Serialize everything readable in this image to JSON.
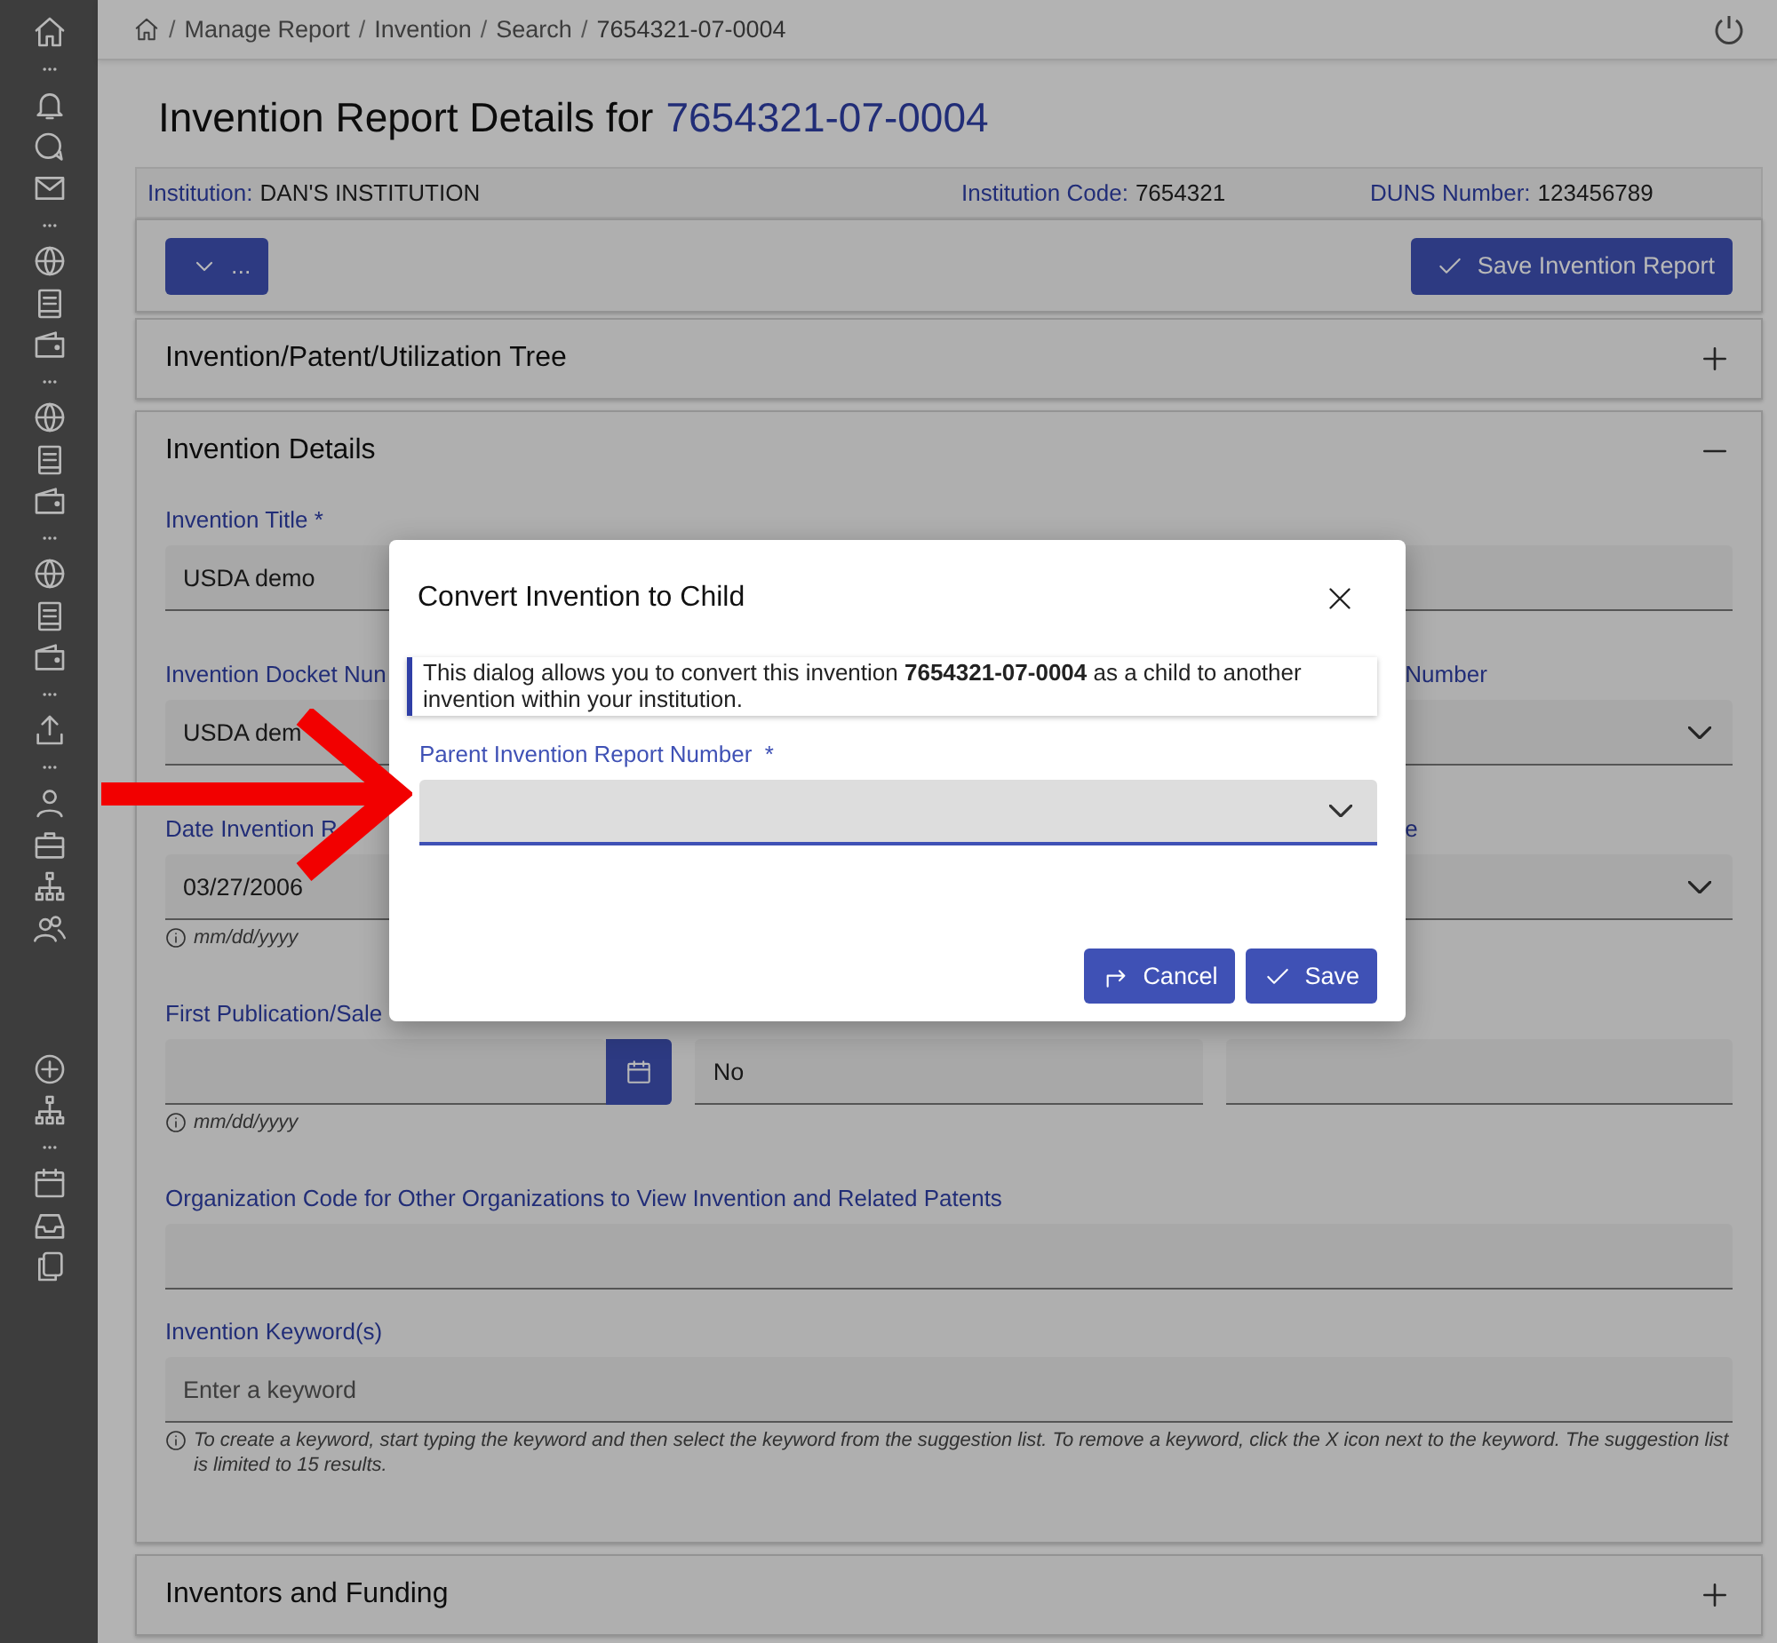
{
  "breadcrumb": [
    {
      "kind": "separator",
      "text": "/"
    },
    {
      "kind": "link",
      "text": "Manage Report"
    },
    {
      "kind": "separator",
      "text": "/"
    },
    {
      "kind": "link",
      "text": "Invention"
    },
    {
      "kind": "separator",
      "text": "/"
    },
    {
      "kind": "link",
      "text": "Search"
    },
    {
      "kind": "separator",
      "text": "/"
    },
    {
      "kind": "current",
      "text": "7654321-07-0004"
    }
  ],
  "page_title": {
    "text": "Invention Report Details for",
    "number": "7654321-07-0004"
  },
  "institution_bar": [
    {
      "label": "Institution:",
      "value": "DAN'S INSTITUTION"
    },
    {
      "label": "Institution Code:",
      "value": "7654321"
    },
    {
      "label": "DUNS Number:",
      "value": "123456789"
    }
  ],
  "toolbar": {
    "menu_button": "...",
    "save_button": "Save Invention Report"
  },
  "sections": [
    {
      "title": "Invention/Patent/Utilization Tree",
      "expanded": false
    },
    {
      "title": "Invention Details",
      "expanded": true
    },
    {
      "title": "Inventors and Funding",
      "expanded": false
    }
  ],
  "details_rows": [
    [
      {
        "label": "Invention Title *",
        "kind": "text",
        "value": "USDA demo"
      }
    ],
    [
      {
        "label": "Invention Docket Nun",
        "kind": "text",
        "value": "USDA dem"
      },
      {
        "label": "Number",
        "kind": "select"
      }
    ],
    [
      {
        "label": "Date Invention R",
        "kind": "text",
        "value": "03/27/2006",
        "hint": "mm/dd/yyyy"
      },
      {
        "label": "e",
        "kind": "select"
      }
    ],
    [
      {
        "label": "First Publication/Sale",
        "kind": "date",
        "hint": "mm/dd/yyyy"
      },
      {
        "kind": "text",
        "value": "No"
      },
      {
        "kind": "text"
      }
    ],
    [
      {
        "label": "Organization Code for Other Organizations to View Invention and Related Patents",
        "kind": "text"
      }
    ],
    [
      {
        "label": "Invention Keyword(s)",
        "kind": "text",
        "placeholder": "Enter a keyword",
        "hint": "To create a keyword, start typing the keyword and then select the keyword from the suggestion list. To remove a keyword, click the X icon next to the keyword. The suggestion list is limited to 15 results."
      }
    ]
  ],
  "dialog": {
    "title": "Convert Invention to Child",
    "info": "This dialog allows you to convert this invention **7654321-07-0004** as a child to another invention within your institution.",
    "field_label": "Parent Invention Report Number  *",
    "buttons": [
      {
        "kind": "cancel",
        "label": "Cancel"
      },
      {
        "kind": "save",
        "label": "Save"
      }
    ]
  }
}
